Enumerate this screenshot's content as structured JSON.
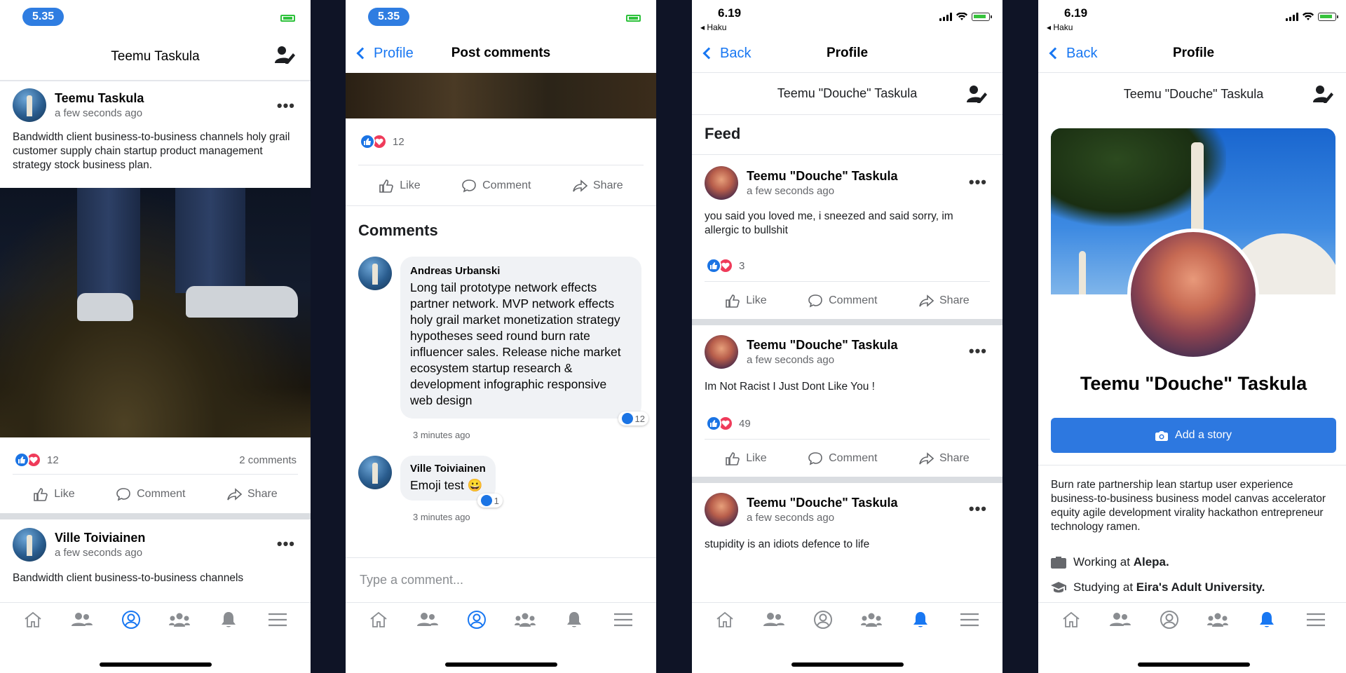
{
  "colors": {
    "accent": "#1877f2",
    "like": "#1b74e4",
    "heart": "#ef3b5a",
    "background": "#0f1426"
  },
  "panel1": {
    "status_time": "5.35",
    "header_title": "Teemu  Taskula",
    "post1": {
      "author": "Teemu Taskula",
      "time": "a few seconds ago",
      "text": "Bandwidth client business-to-business channels holy grail customer supply chain startup product management strategy stock business plan.",
      "reaction_count": "12",
      "comments_count": "2 comments"
    },
    "post2": {
      "author": "Ville Toiviainen",
      "time": "a few seconds ago",
      "text": "Bandwidth client business-to-business channels"
    }
  },
  "panel2": {
    "status_time": "5.35",
    "back_label": "Profile",
    "title": "Post comments",
    "reaction_count": "12",
    "comments_heading": "Comments",
    "comments": [
      {
        "author": "Andreas Urbanski",
        "text": "Long tail prototype network effects partner network. MVP network effects holy grail market monetization strategy hypotheses seed round burn rate influencer sales. Release niche market ecosystem startup research & development infographic responsive web design",
        "likes": "12",
        "time": "3 minutes ago"
      },
      {
        "author": "Ville Toiviainen",
        "text": "Emoji test 😀",
        "likes": "1",
        "time": "3 minutes ago"
      }
    ],
    "input_placeholder": "Type a comment..."
  },
  "panel3": {
    "status_time": "6.19",
    "back_app": "◂ Haku",
    "back_label": "Back",
    "title": "Profile",
    "profile_name": "Teemu  \"Douche\" Taskula",
    "feed_heading": "Feed",
    "posts": [
      {
        "author": "Teemu  \"Douche\" Taskula",
        "time": "a few seconds ago",
        "text": "you said you loved me, i sneezed and said sorry, im allergic to bullshit",
        "reaction_count": "3"
      },
      {
        "author": "Teemu  \"Douche\" Taskula",
        "time": "a few seconds ago",
        "text": "Im Not Racist I Just Dont Like You !",
        "reaction_count": "49"
      },
      {
        "author": "Teemu  \"Douche\" Taskula",
        "time": "a few seconds ago",
        "text": "stupidity is an idiots defence to life"
      }
    ]
  },
  "panel4": {
    "status_time": "6.19",
    "back_app": "◂ Haku",
    "back_label": "Back",
    "title": "Profile",
    "profile_name": "Teemu  \"Douche\" Taskula",
    "big_name": "Teemu \"Douche\" Taskula",
    "story_button": "Add a story",
    "bio": "Burn rate partnership lean startup user experience business-to-business business model canvas accelerator equity agile development virality hackathon entrepreneur technology ramen.",
    "work_prefix": "Working at",
    "work_place": "Alepa.",
    "study_prefix": "Studying at",
    "study_place": "Eira's Adult University."
  },
  "actions": {
    "like": "Like",
    "comment": "Comment",
    "share": "Share"
  },
  "tabbar_icons": [
    "home-icon",
    "friends-icon",
    "profile-icon",
    "groups-icon",
    "bell-icon",
    "menu-icon"
  ]
}
